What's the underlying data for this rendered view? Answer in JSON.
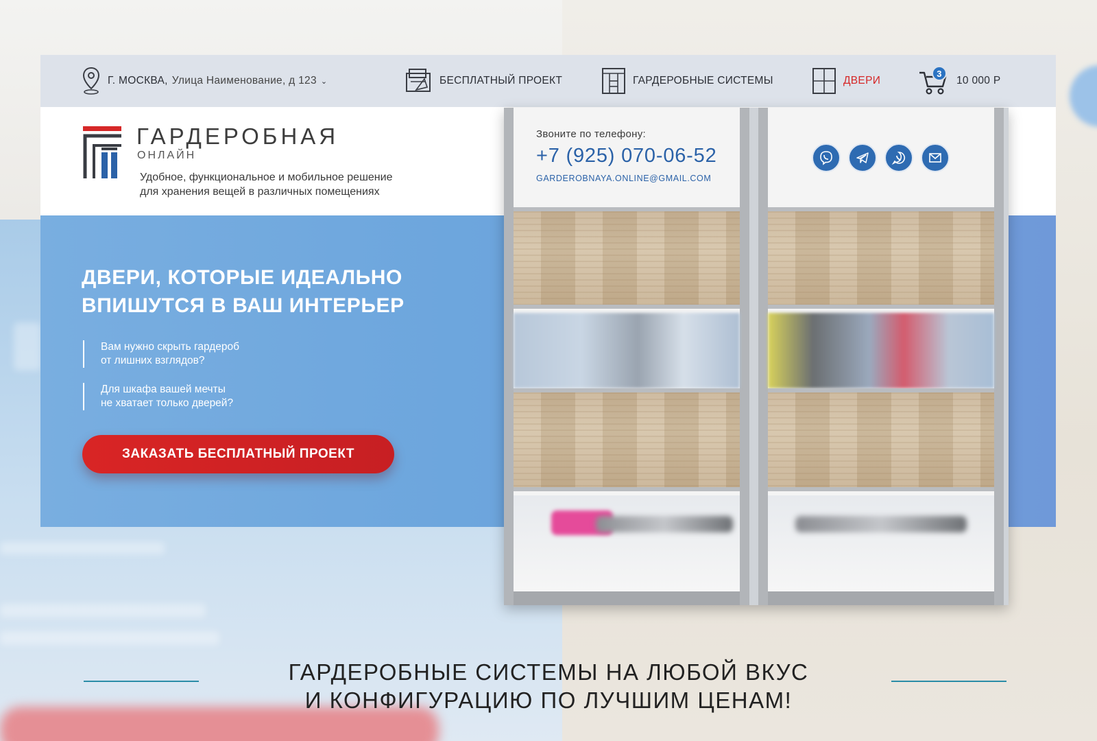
{
  "topbar": {
    "location_city": "Г. МОСКВА,",
    "location_street": "Улица Наименование, д 123",
    "location_chevron": "⌄",
    "nav_project": "БЕСПЛАТНЫЙ ПРОЕКТ",
    "nav_systems": "ГАРДЕРОБНЫЕ СИСТЕМЫ",
    "nav_doors": "ДВЕРИ",
    "cart_count": "3",
    "cart_total": "10 000 Р"
  },
  "brand": {
    "name": "ГАРДЕРОБНАЯ",
    "sub": "ОНЛАЙН",
    "desc_line1": "Удобное, функциональное и мобильное решение",
    "desc_line2": "для хранения вещей в различных помещениях"
  },
  "contacts": {
    "label": "Звоните по телефону:",
    "phone": "+7 (925) 070-06-52",
    "email": "GARDEROBNAYA.ONLINE@GMAIL.COM",
    "socials": [
      "viber-icon",
      "telegram-icon",
      "whatsapp-icon",
      "mail-icon"
    ]
  },
  "hero": {
    "title_line1": "ДВЕРИ, КОТОРЫЕ ИДЕАЛЬНО",
    "title_line2": "ВПИШУТСЯ В ВАШ ИНТЕРЬЕР",
    "q1_line1": "Вам нужно скрыть гардероб",
    "q1_line2": "от лишних взглядов?",
    "q2_line1": "Для шкафа вашей мечты",
    "q2_line2": "не хватает только дверей?",
    "cta_label": "ЗАКАЗАТЬ БЕСПЛАТНЫЙ ПРОЕКТ"
  },
  "bottom": {
    "title_line1": "ГАРДЕРОБНЫЕ СИСТЕМЫ НА ЛЮБОЙ ВКУС",
    "title_line2": "И КОНФИГУРАЦИЮ ПО ЛУЧШИМ ЦЕНАМ!"
  },
  "colors": {
    "accent_red": "#d62828",
    "accent_blue": "#2b62a8",
    "hero_blue": "#6da6dd",
    "topbar_bg": "#dde2ea"
  }
}
